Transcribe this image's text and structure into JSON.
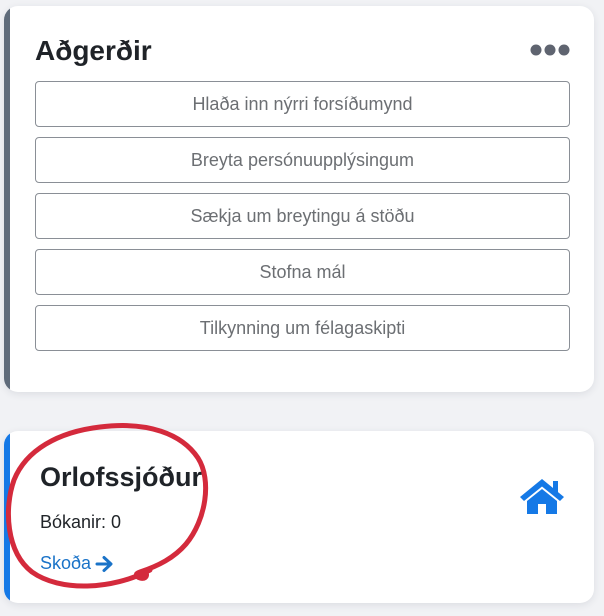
{
  "actions_card": {
    "title": "Aðgerðir",
    "more_icon": "more-horizontal-icon",
    "accent_color": "#5f6b7a",
    "buttons": [
      "Hlaða inn nýrri forsíðumynd",
      "Breyta persónuupplýsingum",
      "Sækja um breytingu á stöðu",
      "Stofna mál",
      "Tilkynning um félagaskipti"
    ]
  },
  "fund_card": {
    "title": "Orlofssjóður",
    "bookings_label": "Bókanir:",
    "bookings_count": "0",
    "link_label": "Skoða",
    "link_icon": "arrow-right-icon",
    "home_icon": "home-icon",
    "accent_color": "#1579e6",
    "link_color": "#1a73c8"
  },
  "annotation": {
    "type": "red-circle",
    "color": "#d42a3c"
  }
}
